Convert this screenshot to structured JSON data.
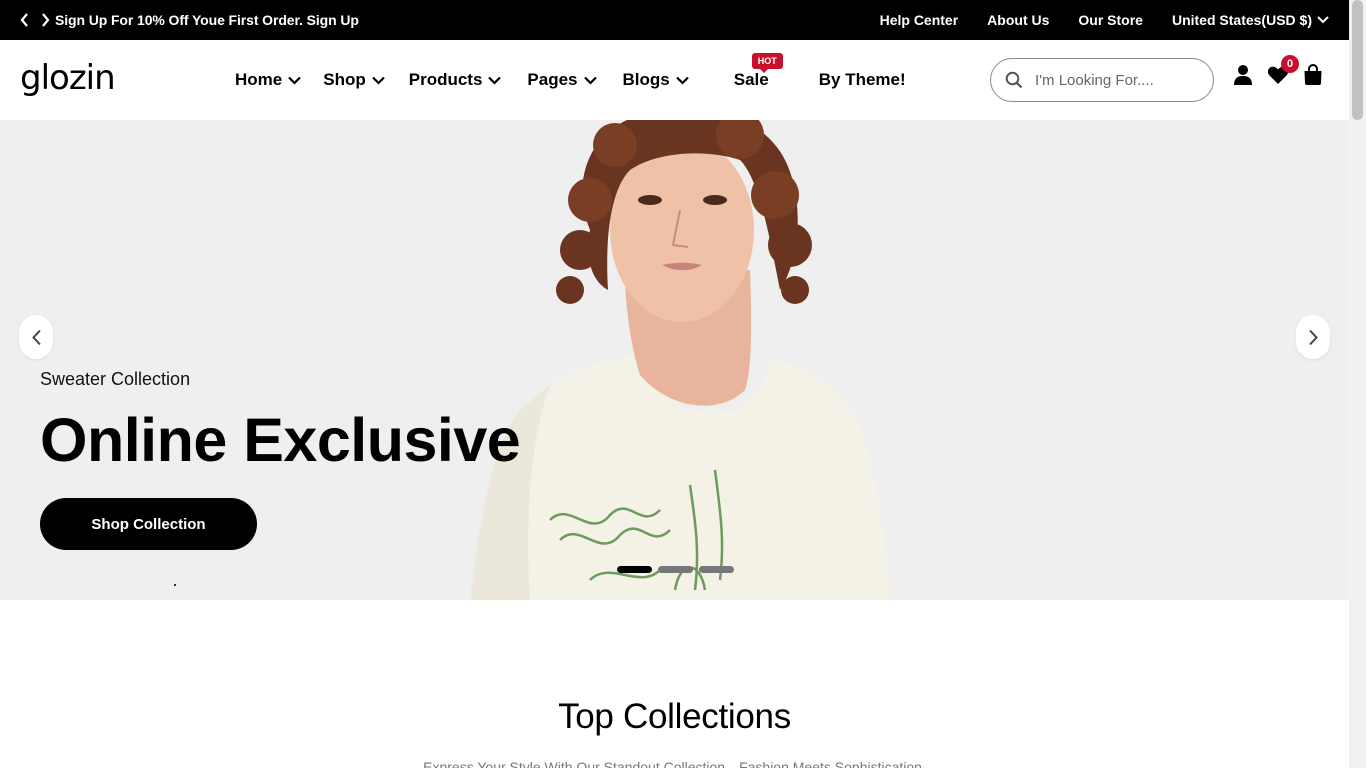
{
  "announcement": {
    "text": "Sign Up For 10% Off Youe First Order. Sign Up",
    "links": [
      "Help Center",
      "About Us",
      "Our Store"
    ],
    "currency": "United States(USD $)"
  },
  "header": {
    "logo": "glozin",
    "nav": [
      {
        "label": "Home",
        "dropdown": true
      },
      {
        "label": "Shop",
        "dropdown": true
      },
      {
        "label": "Products",
        "dropdown": true
      },
      {
        "label": "Pages",
        "dropdown": true
      },
      {
        "label": "Blogs",
        "dropdown": true
      },
      {
        "label": "Sale",
        "badge": "HOT"
      },
      {
        "label": "By Theme!"
      }
    ],
    "search_placeholder": "I'm Looking For....",
    "wishlist_count": "0"
  },
  "hero": {
    "subtitle": "Sweater Collection",
    "title": "Online Exclusive",
    "button": "Shop Collection",
    "slides": 3,
    "active_slide": 1
  },
  "section": {
    "title": "Top Collections",
    "subtitle": "Express Your Style With Our Standout Collection—Fashion Meets Sophistication."
  },
  "colors": {
    "accent": "#c8102e",
    "dark": "#000000",
    "hero_bg": "#efefef"
  },
  "icons": [
    "chevron-left-icon",
    "chevron-right-icon",
    "chevron-down-icon",
    "search-icon",
    "user-icon",
    "heart-icon",
    "bag-icon"
  ]
}
